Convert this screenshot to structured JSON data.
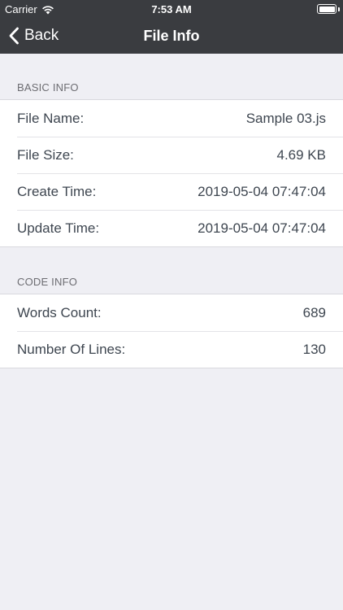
{
  "status_bar": {
    "carrier": "Carrier",
    "time": "7:53 AM"
  },
  "nav": {
    "back_label": "Back",
    "title": "File Info"
  },
  "sections": {
    "basic": {
      "header": "BASIC INFO",
      "rows": [
        {
          "label": "File Name:",
          "value": "Sample 03.js"
        },
        {
          "label": "File Size:",
          "value": "4.69 KB"
        },
        {
          "label": "Create Time:",
          "value": "2019-05-04 07:47:04"
        },
        {
          "label": "Update Time:",
          "value": "2019-05-04 07:47:04"
        }
      ]
    },
    "code": {
      "header": "CODE INFO",
      "rows": [
        {
          "label": "Words Count:",
          "value": "689"
        },
        {
          "label": "Number Of Lines:",
          "value": "130"
        }
      ]
    }
  },
  "colors": {
    "nav_background": "#3a3c40",
    "page_background": "#efeff4",
    "text": "#3e4650",
    "section_header": "#6d6d72"
  }
}
